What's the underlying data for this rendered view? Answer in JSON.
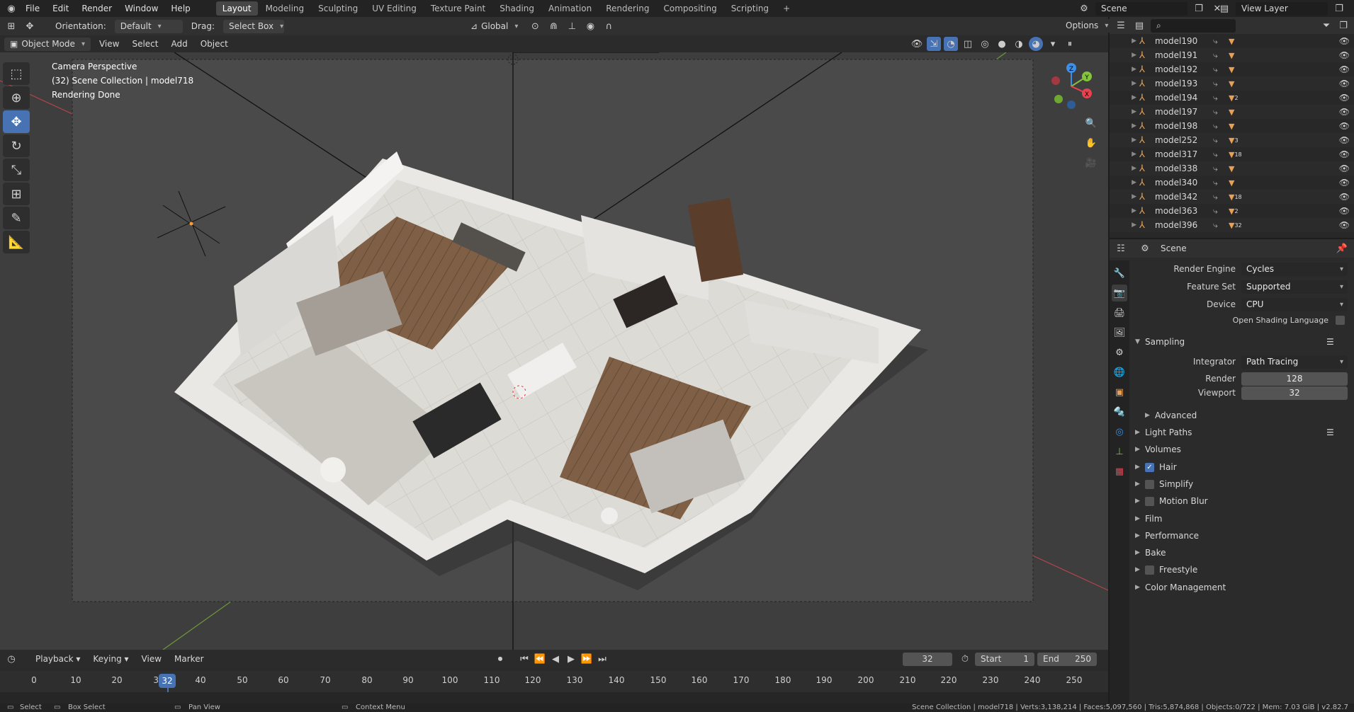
{
  "menu": {
    "items": [
      "File",
      "Edit",
      "Render",
      "Window",
      "Help"
    ],
    "workspaces": [
      "Layout",
      "Modeling",
      "Sculpting",
      "UV Editing",
      "Texture Paint",
      "Shading",
      "Animation",
      "Rendering",
      "Compositing",
      "Scripting"
    ],
    "add_workspace": "+",
    "scene_name": "Scene",
    "view_layer": "View Layer"
  },
  "tool_header": {
    "orientation_label": "Orientation:",
    "orientation_value": "Default",
    "drag_label": "Drag:",
    "drag_value": "Select Box",
    "transform_value": "Global",
    "options_label": "Options"
  },
  "viewport_header": {
    "mode": "Object Mode",
    "menus": [
      "View",
      "Select",
      "Add",
      "Object"
    ]
  },
  "viewport": {
    "overlay_line1": "Camera Perspective",
    "overlay_line2": "(32) Scene Collection | model718",
    "overlay_line3": "Rendering Done",
    "gizmo_x": "X",
    "gizmo_y": "Y",
    "gizmo_z": "Z"
  },
  "outliner": {
    "search_placeholder": "",
    "rows": [
      {
        "name": "model190",
        "badge": ""
      },
      {
        "name": "model191",
        "badge": ""
      },
      {
        "name": "model192",
        "badge": ""
      },
      {
        "name": "model193",
        "badge": ""
      },
      {
        "name": "model194",
        "badge": "2"
      },
      {
        "name": "model197",
        "badge": ""
      },
      {
        "name": "model198",
        "badge": ""
      },
      {
        "name": "model252",
        "badge": "3"
      },
      {
        "name": "model317",
        "badge": "18"
      },
      {
        "name": "model338",
        "badge": ""
      },
      {
        "name": "model340",
        "badge": ""
      },
      {
        "name": "model342",
        "badge": "18"
      },
      {
        "name": "model363",
        "badge": "2"
      },
      {
        "name": "model396",
        "badge": "32"
      }
    ]
  },
  "properties": {
    "context_title": "Scene",
    "render_engine_label": "Render Engine",
    "render_engine": "Cycles",
    "feature_set_label": "Feature Set",
    "feature_set": "Supported",
    "device_label": "Device",
    "device": "CPU",
    "osl_label": "Open Shading Language",
    "sampling_label": "Sampling",
    "integrator_label": "Integrator",
    "integrator": "Path Tracing",
    "render_label": "Render",
    "render_samples": "128",
    "viewport_label": "Viewport",
    "viewport_samples": "32",
    "advanced_label": "Advanced",
    "panels": [
      {
        "label": "Light Paths",
        "checkbox": "none"
      },
      {
        "label": "Volumes",
        "checkbox": "none"
      },
      {
        "label": "Hair",
        "checkbox": "on"
      },
      {
        "label": "Simplify",
        "checkbox": "off"
      },
      {
        "label": "Motion Blur",
        "checkbox": "off"
      },
      {
        "label": "Film",
        "checkbox": "none"
      },
      {
        "label": "Performance",
        "checkbox": "none"
      },
      {
        "label": "Bake",
        "checkbox": "none"
      },
      {
        "label": "Freestyle",
        "checkbox": "off"
      },
      {
        "label": "Color Management",
        "checkbox": "none"
      }
    ]
  },
  "timeline": {
    "menus": [
      "Playback",
      "Keying",
      "View",
      "Marker"
    ],
    "current_frame": "32",
    "start_label": "Start",
    "start": "1",
    "end_label": "End",
    "end": "250",
    "ticks": [
      "0",
      "10",
      "20",
      "30",
      "40",
      "50",
      "60",
      "70",
      "80",
      "90",
      "100",
      "110",
      "120",
      "130",
      "140",
      "150",
      "160",
      "170",
      "180",
      "190",
      "200",
      "210",
      "220",
      "230",
      "240",
      "250"
    ],
    "playhead_label": "32"
  },
  "statusbar": {
    "select": "Select",
    "box_select": "Box Select",
    "pan_view": "Pan View",
    "context_menu": "Context Menu",
    "stats": "Scene Collection | model718 | Verts:3,138,214 | Faces:5,097,560 | Tris:5,874,868 | Objects:0/722 | Mem: 7.03 GiB | v2.82.7"
  },
  "colors": {
    "accent": "#4772b3",
    "object_orange": "#e8a055",
    "axis_x": "#e8414f",
    "axis_y": "#84c43a",
    "axis_z": "#3f8fe6"
  }
}
